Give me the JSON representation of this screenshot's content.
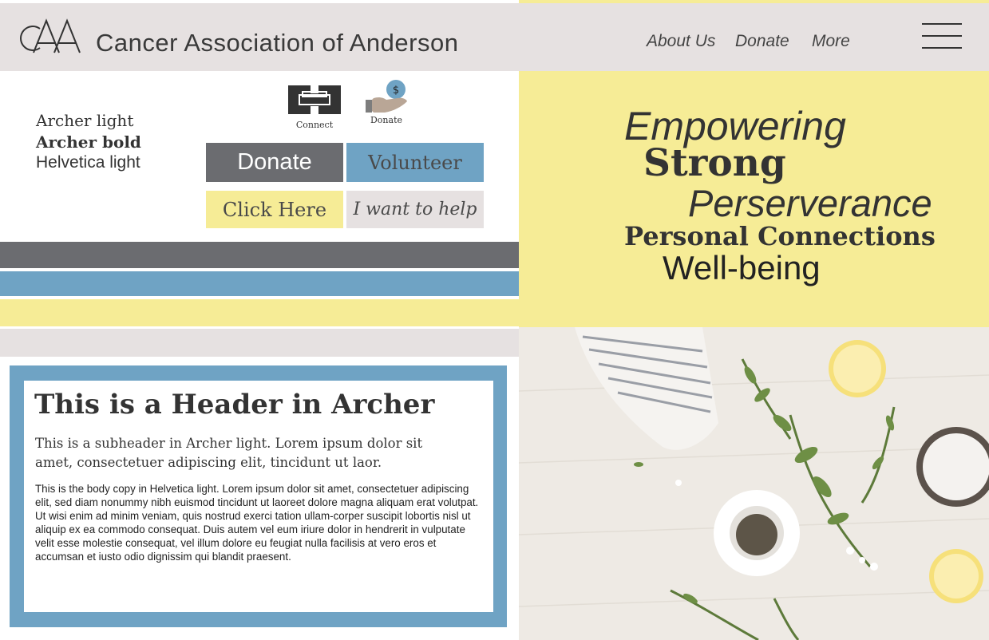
{
  "header": {
    "logo_text": "CAA",
    "title": "Cancer Association of Anderson",
    "nav": [
      "About Us",
      "Donate",
      "More"
    ],
    "menu_icon": "hamburger-menu-icon"
  },
  "style_guide": {
    "font_samples": [
      "Archer light",
      "Archer bold",
      "Helvetica light"
    ],
    "icons": [
      {
        "icon": "connect-icon",
        "label": "Connect"
      },
      {
        "icon": "donate-hand-coin-icon",
        "label": "Donate",
        "coin_symbol": "$"
      }
    ],
    "buttons": [
      {
        "label": "Donate",
        "bg": "#6b6c70",
        "color": "#ffffff"
      },
      {
        "label": "Volunteer",
        "bg": "#6fa3c4",
        "color": "#4a4a4a"
      },
      {
        "label": "Click Here",
        "bg": "#f6ec96",
        "color": "#4a4a4a"
      },
      {
        "label": "I want to help",
        "bg": "#e6e1e1",
        "color": "#4a4a4a"
      }
    ],
    "palette": [
      "#6b6c70",
      "#6fa3c4",
      "#f6ec96",
      "#e6e1e1"
    ]
  },
  "tagline_words": [
    "Empowering",
    "Strong",
    "Perserverance",
    "Personal Connections",
    "Well-being"
  ],
  "card": {
    "header": "This is a Header in Archer",
    "subheader": "This is a subheader in Archer light. Lorem ipsum dolor sit amet, consectetuer adipiscing elit,  tincidunt ut laor.",
    "body": "This is the body copy in Helvetica light. Lorem ipsum dolor sit amet, consectetuer adipiscing elit, sed diam nonummy nibh euismod tincidunt ut laoreet dolore magna aliquam erat volutpat. Ut wisi enim ad minim veniam, quis nostrud exerci tation ullam-corper suscipit lobortis nisl ut aliquip ex ea commodo consequat. Duis autem vel eum iriure dolor in hendrerit in vulputate velit esse molestie consequat, vel illum dolore eu feugiat nulla facilisis at vero eros et accumsan et iusto odio dignissim qui blandit praesent."
  },
  "photo": {
    "subject": "herbs-lemons-salt-photo"
  }
}
